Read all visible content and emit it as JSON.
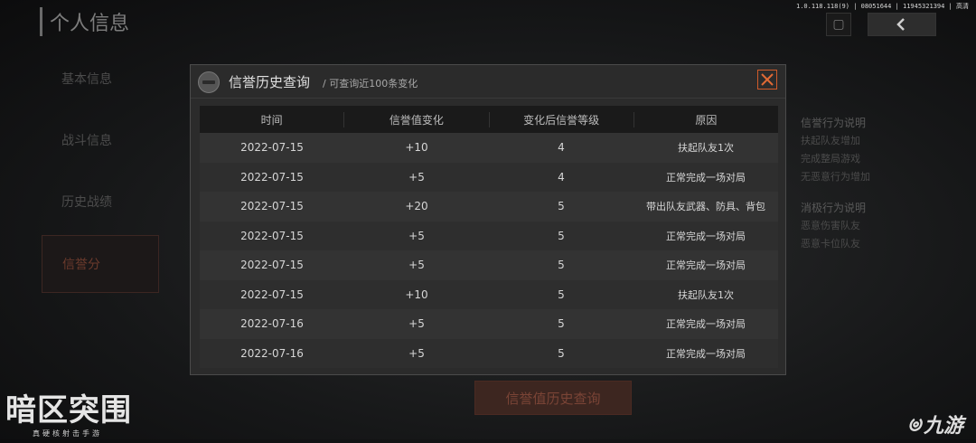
{
  "page": {
    "title": "个人信息",
    "version": "1.0.118.118(9) | 08051644 | 11945321394 | 高清"
  },
  "sidebar": {
    "items": [
      {
        "label": "基本信息"
      },
      {
        "label": "战斗信息"
      },
      {
        "label": "历史战绩"
      },
      {
        "label": "信誉分"
      }
    ]
  },
  "right_panel": {
    "positive_title": "信誉行为说明",
    "positive_lines": [
      "扶起队友增加",
      "完成整局游戏",
      "无恶意行为增加"
    ],
    "negative_title": "消极行为说明",
    "negative_lines": [
      "恶意伤害队友",
      "恶意卡位队友"
    ]
  },
  "dialog": {
    "title": "信誉历史查询",
    "subtitle": "/ 可查询近100条变化",
    "columns": [
      "时间",
      "信誉值变化",
      "变化后信誉等级",
      "原因"
    ],
    "rows": [
      {
        "date": "2022-07-15",
        "change": "+10",
        "level": "4",
        "reason": "扶起队友1次"
      },
      {
        "date": "2022-07-15",
        "change": "+5",
        "level": "4",
        "reason": "正常完成一场对局"
      },
      {
        "date": "2022-07-15",
        "change": "+20",
        "level": "5",
        "reason": "带出队友武器、防具、背包"
      },
      {
        "date": "2022-07-15",
        "change": "+5",
        "level": "5",
        "reason": "正常完成一场对局"
      },
      {
        "date": "2022-07-15",
        "change": "+5",
        "level": "5",
        "reason": "正常完成一场对局"
      },
      {
        "date": "2022-07-15",
        "change": "+10",
        "level": "5",
        "reason": "扶起队友1次"
      },
      {
        "date": "2022-07-16",
        "change": "+5",
        "level": "5",
        "reason": "正常完成一场对局"
      },
      {
        "date": "2022-07-16",
        "change": "+5",
        "level": "5",
        "reason": "正常完成一场对局"
      }
    ]
  },
  "bottom_button": {
    "label": "信誉值历史查询"
  },
  "branding": {
    "logo": "暗区突围",
    "logo_sub": "真硬核射击手游",
    "watermark": "九游"
  },
  "colors": {
    "accent": "#cf5a2a",
    "dialog_bg": "#2b2b2b",
    "header_bg": "#1a1a1a"
  }
}
